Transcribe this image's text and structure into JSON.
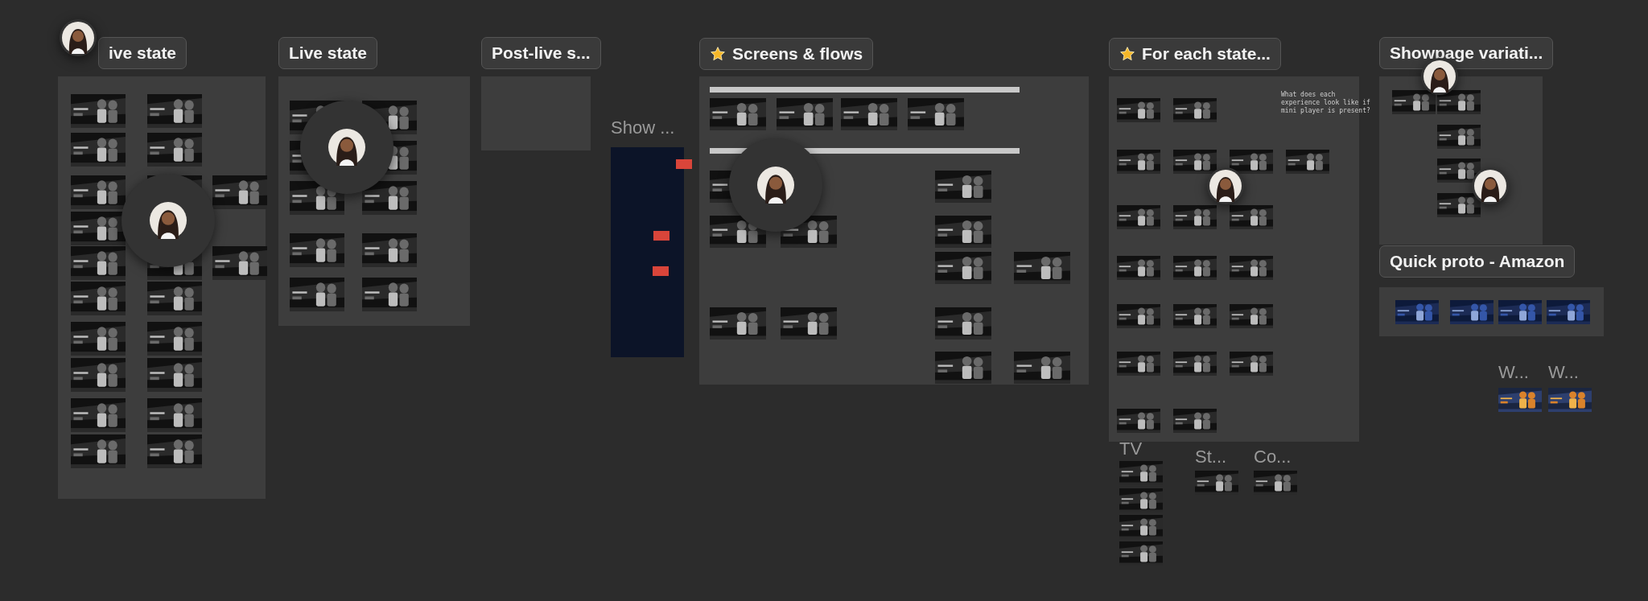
{
  "labels": [
    {
      "title": "ive state",
      "kind": "chip",
      "starred": false
    },
    {
      "title": "Live state",
      "kind": "chip",
      "starred": false
    },
    {
      "title": "Post-live s...",
      "kind": "chip",
      "starred": false
    },
    {
      "title": "Show ...",
      "kind": "plain",
      "starred": false
    },
    {
      "title": "Screens & flows",
      "kind": "chip",
      "starred": true
    },
    {
      "title": "For each state...",
      "kind": "chip",
      "starred": true
    },
    {
      "title": "What does each experience look like if mini player is present?",
      "kind": "note",
      "starred": false
    },
    {
      "title": "Showpage variati...",
      "kind": "chip",
      "starred": false
    },
    {
      "title": "Quick proto - Amazon",
      "kind": "chip",
      "starred": false
    },
    {
      "title": "W...",
      "kind": "plain",
      "starred": false
    },
    {
      "title": "W...",
      "kind": "plain",
      "starred": false
    },
    {
      "title": "TV",
      "kind": "plain",
      "starred": false
    },
    {
      "title": "St...",
      "kind": "plain",
      "starred": false
    },
    {
      "title": "Co...",
      "kind": "plain",
      "starred": false
    }
  ],
  "cursors": [
    {
      "kind": "small"
    },
    {
      "kind": "large"
    },
    {
      "kind": "large"
    },
    {
      "kind": "large"
    },
    {
      "kind": "small"
    },
    {
      "kind": "small"
    },
    {
      "kind": "small"
    }
  ]
}
